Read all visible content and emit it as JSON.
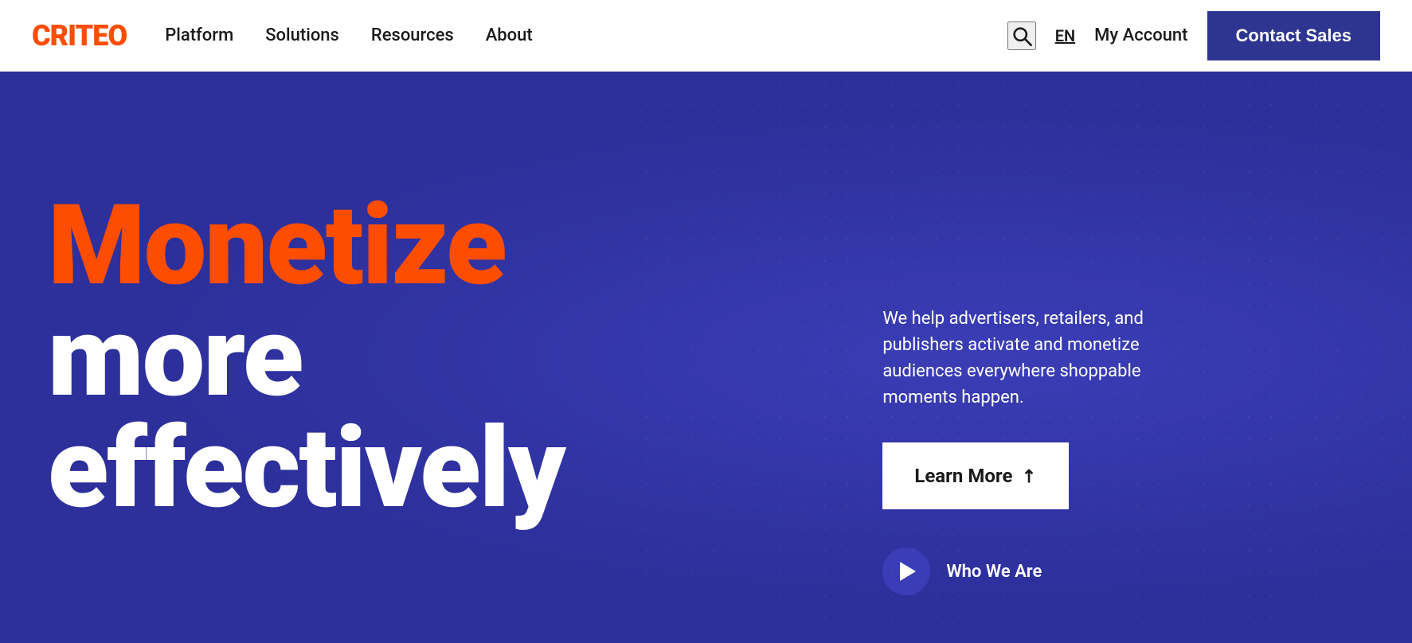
{
  "header": {
    "logo_text": "CRITEO",
    "nav_items": [
      {
        "label": "Platform",
        "id": "platform"
      },
      {
        "label": "Solutions",
        "id": "solutions"
      },
      {
        "label": "Resources",
        "id": "resources"
      },
      {
        "label": "About",
        "id": "about"
      }
    ],
    "lang": "EN",
    "my_account": "My Account",
    "contact_sales": "Contact Sales"
  },
  "hero": {
    "headline_orange": "Monetize",
    "headline_white_1": "more",
    "headline_white_2": "effectively",
    "description": "We help advertisers, retailers, and publishers activate and monetize audiences everywhere shoppable moments happen.",
    "learn_more_label": "Learn More",
    "arrow_symbol": "↗",
    "who_we_are_label": "Who We Are"
  },
  "colors": {
    "brand_orange": "#ff4d00",
    "brand_navy": "#2d3591",
    "hero_bg": "#2d2f9b",
    "white": "#ffffff"
  }
}
